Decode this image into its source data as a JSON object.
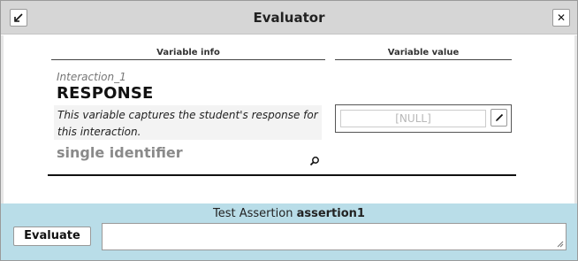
{
  "window": {
    "title": "Evaluator",
    "minimize_icon": "collapse-arrow-icon",
    "close_icon": "close-icon"
  },
  "columns": {
    "info_header": "Variable info",
    "value_header": "Variable value"
  },
  "variable": {
    "interaction": "Interaction_1",
    "name": "RESPONSE",
    "description": "This variable captures the student's response for this interaction.",
    "type": "single identifier",
    "value": "[NULL]"
  },
  "footer": {
    "assertion_prefix": "Test Assertion",
    "assertion_name": "assertion1",
    "evaluate_label": "Evaluate",
    "background_color": "#b9dde8"
  }
}
